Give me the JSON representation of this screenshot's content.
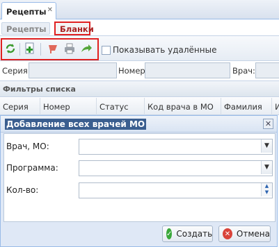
{
  "window_tab": {
    "label": "Рецепты",
    "close": "✕"
  },
  "subtabs": [
    {
      "label": "Рецепты"
    },
    {
      "label": "Бланки"
    }
  ],
  "toolbar": {
    "icons": [
      "refresh-icon",
      "add-icon",
      "delete-icon",
      "print-icon",
      "forward-icon"
    ],
    "show_deleted_label": "Показывать удалённые",
    "show_deleted_checked": false
  },
  "filters": {
    "series_label": "Серия:",
    "number_label": "Номер:",
    "doctor_label": "Врач:"
  },
  "list_filters": {
    "title": "Фильтры списка"
  },
  "grid": {
    "columns": [
      "Серия",
      "Номер",
      "Статус",
      "Код врача в МО",
      "Фамилия",
      "И"
    ]
  },
  "dialog": {
    "title": "Добавление всех врачей МО",
    "fields": [
      {
        "label": "Врач, МО:",
        "value": ""
      },
      {
        "label": "Программа:",
        "value": ""
      },
      {
        "label": "Кол-во:",
        "value": ""
      }
    ],
    "create_label": "Создать",
    "cancel_label": "Отмена"
  },
  "colors": {
    "highlight": "#e02020",
    "title_bg": "#3a5e8f",
    "accent": "#99bbe8"
  }
}
